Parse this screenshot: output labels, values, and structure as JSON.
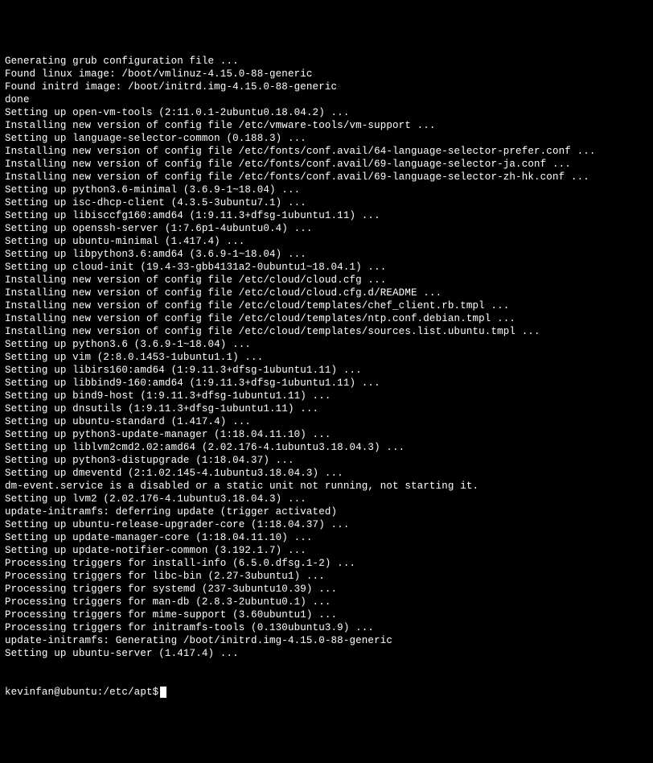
{
  "terminal": {
    "lines": [
      "Generating grub configuration file ...",
      "Found linux image: /boot/vmlinuz-4.15.0-88-generic",
      "Found initrd image: /boot/initrd.img-4.15.0-88-generic",
      "done",
      "Setting up open-vm-tools (2:11.0.1-2ubuntu0.18.04.2) ...",
      "Installing new version of config file /etc/vmware-tools/vm-support ...",
      "Setting up language-selector-common (0.188.3) ...",
      "Installing new version of config file /etc/fonts/conf.avail/64-language-selector-prefer.conf ...",
      "Installing new version of config file /etc/fonts/conf.avail/69-language-selector-ja.conf ...",
      "Installing new version of config file /etc/fonts/conf.avail/69-language-selector-zh-hk.conf ...",
      "Setting up python3.6-minimal (3.6.9-1~18.04) ...",
      "Setting up isc-dhcp-client (4.3.5-3ubuntu7.1) ...",
      "Setting up libisccfg160:amd64 (1:9.11.3+dfsg-1ubuntu1.11) ...",
      "Setting up openssh-server (1:7.6p1-4ubuntu0.4) ...",
      "Setting up ubuntu-minimal (1.417.4) ...",
      "Setting up libpython3.6:amd64 (3.6.9-1~18.04) ...",
      "Setting up cloud-init (19.4-33-gbb4131a2-0ubuntu1~18.04.1) ...",
      "Installing new version of config file /etc/cloud/cloud.cfg ...",
      "Installing new version of config file /etc/cloud/cloud.cfg.d/README ...",
      "Installing new version of config file /etc/cloud/templates/chef_client.rb.tmpl ...",
      "Installing new version of config file /etc/cloud/templates/ntp.conf.debian.tmpl ...",
      "Installing new version of config file /etc/cloud/templates/sources.list.ubuntu.tmpl ...",
      "Setting up python3.6 (3.6.9-1~18.04) ...",
      "Setting up vim (2:8.0.1453-1ubuntu1.1) ...",
      "Setting up libirs160:amd64 (1:9.11.3+dfsg-1ubuntu1.11) ...",
      "Setting up libbind9-160:amd64 (1:9.11.3+dfsg-1ubuntu1.11) ...",
      "Setting up bind9-host (1:9.11.3+dfsg-1ubuntu1.11) ...",
      "Setting up dnsutils (1:9.11.3+dfsg-1ubuntu1.11) ...",
      "Setting up ubuntu-standard (1.417.4) ...",
      "Setting up python3-update-manager (1:18.04.11.10) ...",
      "Setting up liblvm2cmd2.02:amd64 (2.02.176-4.1ubuntu3.18.04.3) ...",
      "Setting up python3-distupgrade (1:18.04.37) ...",
      "Setting up dmeventd (2:1.02.145-4.1ubuntu3.18.04.3) ...",
      "dm-event.service is a disabled or a static unit not running, not starting it.",
      "Setting up lvm2 (2.02.176-4.1ubuntu3.18.04.3) ...",
      "update-initramfs: deferring update (trigger activated)",
      "Setting up ubuntu-release-upgrader-core (1:18.04.37) ...",
      "Setting up update-manager-core (1:18.04.11.10) ...",
      "Setting up update-notifier-common (3.192.1.7) ...",
      "Processing triggers for install-info (6.5.0.dfsg.1-2) ...",
      "Processing triggers for libc-bin (2.27-3ubuntu1) ...",
      "Processing triggers for systemd (237-3ubuntu10.39) ...",
      "Processing triggers for man-db (2.8.3-2ubuntu0.1) ...",
      "Processing triggers for mime-support (3.60ubuntu1) ...",
      "Processing triggers for initramfs-tools (0.130ubuntu3.9) ...",
      "update-initramfs: Generating /boot/initrd.img-4.15.0-88-generic",
      "Setting up ubuntu-server (1.417.4) ..."
    ],
    "prompt": "kevinfan@ubuntu:/etc/apt$"
  }
}
